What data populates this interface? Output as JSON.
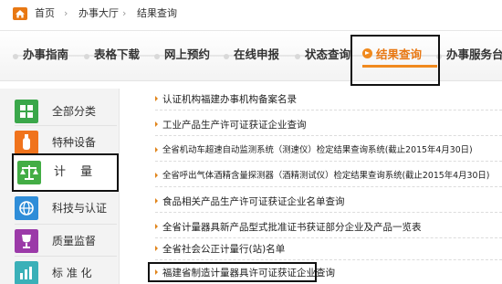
{
  "breadcrumb": {
    "items": [
      "首页",
      "办事大厅",
      "结果查询"
    ],
    "separator": "›",
    "icon": "home-icon"
  },
  "tabs": [
    {
      "label": "办事指南",
      "active": false
    },
    {
      "label": "表格下载",
      "active": false
    },
    {
      "label": "网上预约",
      "active": false
    },
    {
      "label": "在线申报",
      "active": false
    },
    {
      "label": "状态查询",
      "active": false
    },
    {
      "label": "结果查询",
      "active": true
    },
    {
      "label": "办事服务台",
      "active": false
    }
  ],
  "sidebar": {
    "items": [
      {
        "label": "全部分类",
        "icon": "grid-icon",
        "color": "#3aa74a",
        "selected": false
      },
      {
        "label": "特种设备",
        "icon": "gas-cylinder-icon",
        "color": "#f0731c",
        "selected": false
      },
      {
        "label": "计 量",
        "icon": "scale-icon",
        "color": "#43ad45",
        "selected": true
      },
      {
        "label": "科技与认证",
        "icon": "globe-icon",
        "color": "#2f8dd8",
        "selected": false
      },
      {
        "label": "质量监督",
        "icon": "trophy-icon",
        "color": "#9b3aa8",
        "selected": false
      },
      {
        "label": "标 准 化",
        "icon": "bar-chart-icon",
        "color": "#3ab0b8",
        "selected": false
      }
    ]
  },
  "results": [
    "认证机构福建办事机构备案名录",
    "工业产品生产许可证获证企业查询",
    "全省机动车超速自动监测系统（测速仪）检定结果查询系统(截止2015年4月30日)",
    "全省呼出气体酒精含量探测器（酒精测试仪）检定结果查询系统(截止2015年4月30日)",
    "食品相关产品生产许可证获证企业名单查询",
    "全省计量器具新产品型式批准证书获证部分企业及产品一览表",
    "全省社会公正计量行(站)名单",
    "福建省制造计量器具许可证获证企业查询"
  ],
  "colors": {
    "accent": "#f08a1e",
    "active_text": "#e87813",
    "highlight_border": "#111111"
  }
}
